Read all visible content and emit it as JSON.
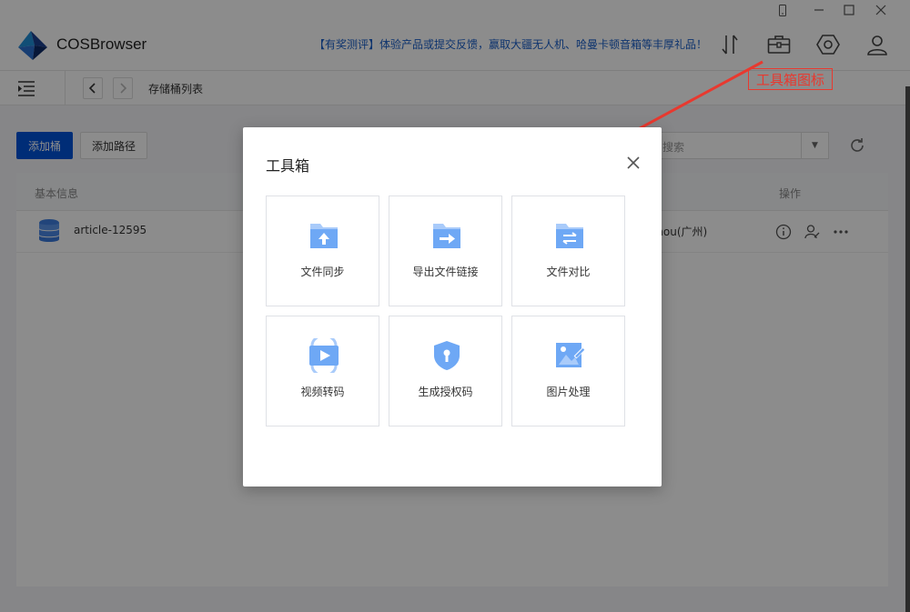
{
  "app": {
    "name": "COSBrowser",
    "promo": "【有奖测评】体验产品或提交反馈，赢取大疆无人机、哈曼卡顿音箱等丰厚礼品！"
  },
  "window_controls": {
    "icons": [
      "phone-icon",
      "minimize-icon",
      "maximize-icon",
      "close-icon"
    ]
  },
  "header_icons": [
    "transfer-icon",
    "toolbox-icon",
    "settings-icon",
    "user-icon"
  ],
  "breadcrumb": "存储桶列表",
  "actions": {
    "add_bucket": "添加桶",
    "add_path": "添加路径",
    "search_placeholder": "搜索"
  },
  "table": {
    "columns": [
      "基本信息",
      "操作"
    ],
    "rows": [
      {
        "name": "article-12595",
        "region": "zhou(广州)"
      }
    ]
  },
  "annotation": {
    "label": "工具箱图标",
    "color": "#e8392f"
  },
  "modal": {
    "title": "工具箱",
    "tools": [
      {
        "label": "文件同步",
        "icon": "folder-upload-icon"
      },
      {
        "label": "导出文件链接",
        "icon": "folder-export-icon"
      },
      {
        "label": "文件对比",
        "icon": "folder-compare-icon"
      },
      {
        "label": "视频转码",
        "icon": "video-transcode-icon"
      },
      {
        "label": "生成授权码",
        "icon": "shield-key-icon"
      },
      {
        "label": "图片处理",
        "icon": "image-edit-icon"
      }
    ]
  },
  "colors": {
    "primary": "#0052d9",
    "tool_icon": "#6ea8f5",
    "tool_icon_light": "#a9cbfa"
  }
}
